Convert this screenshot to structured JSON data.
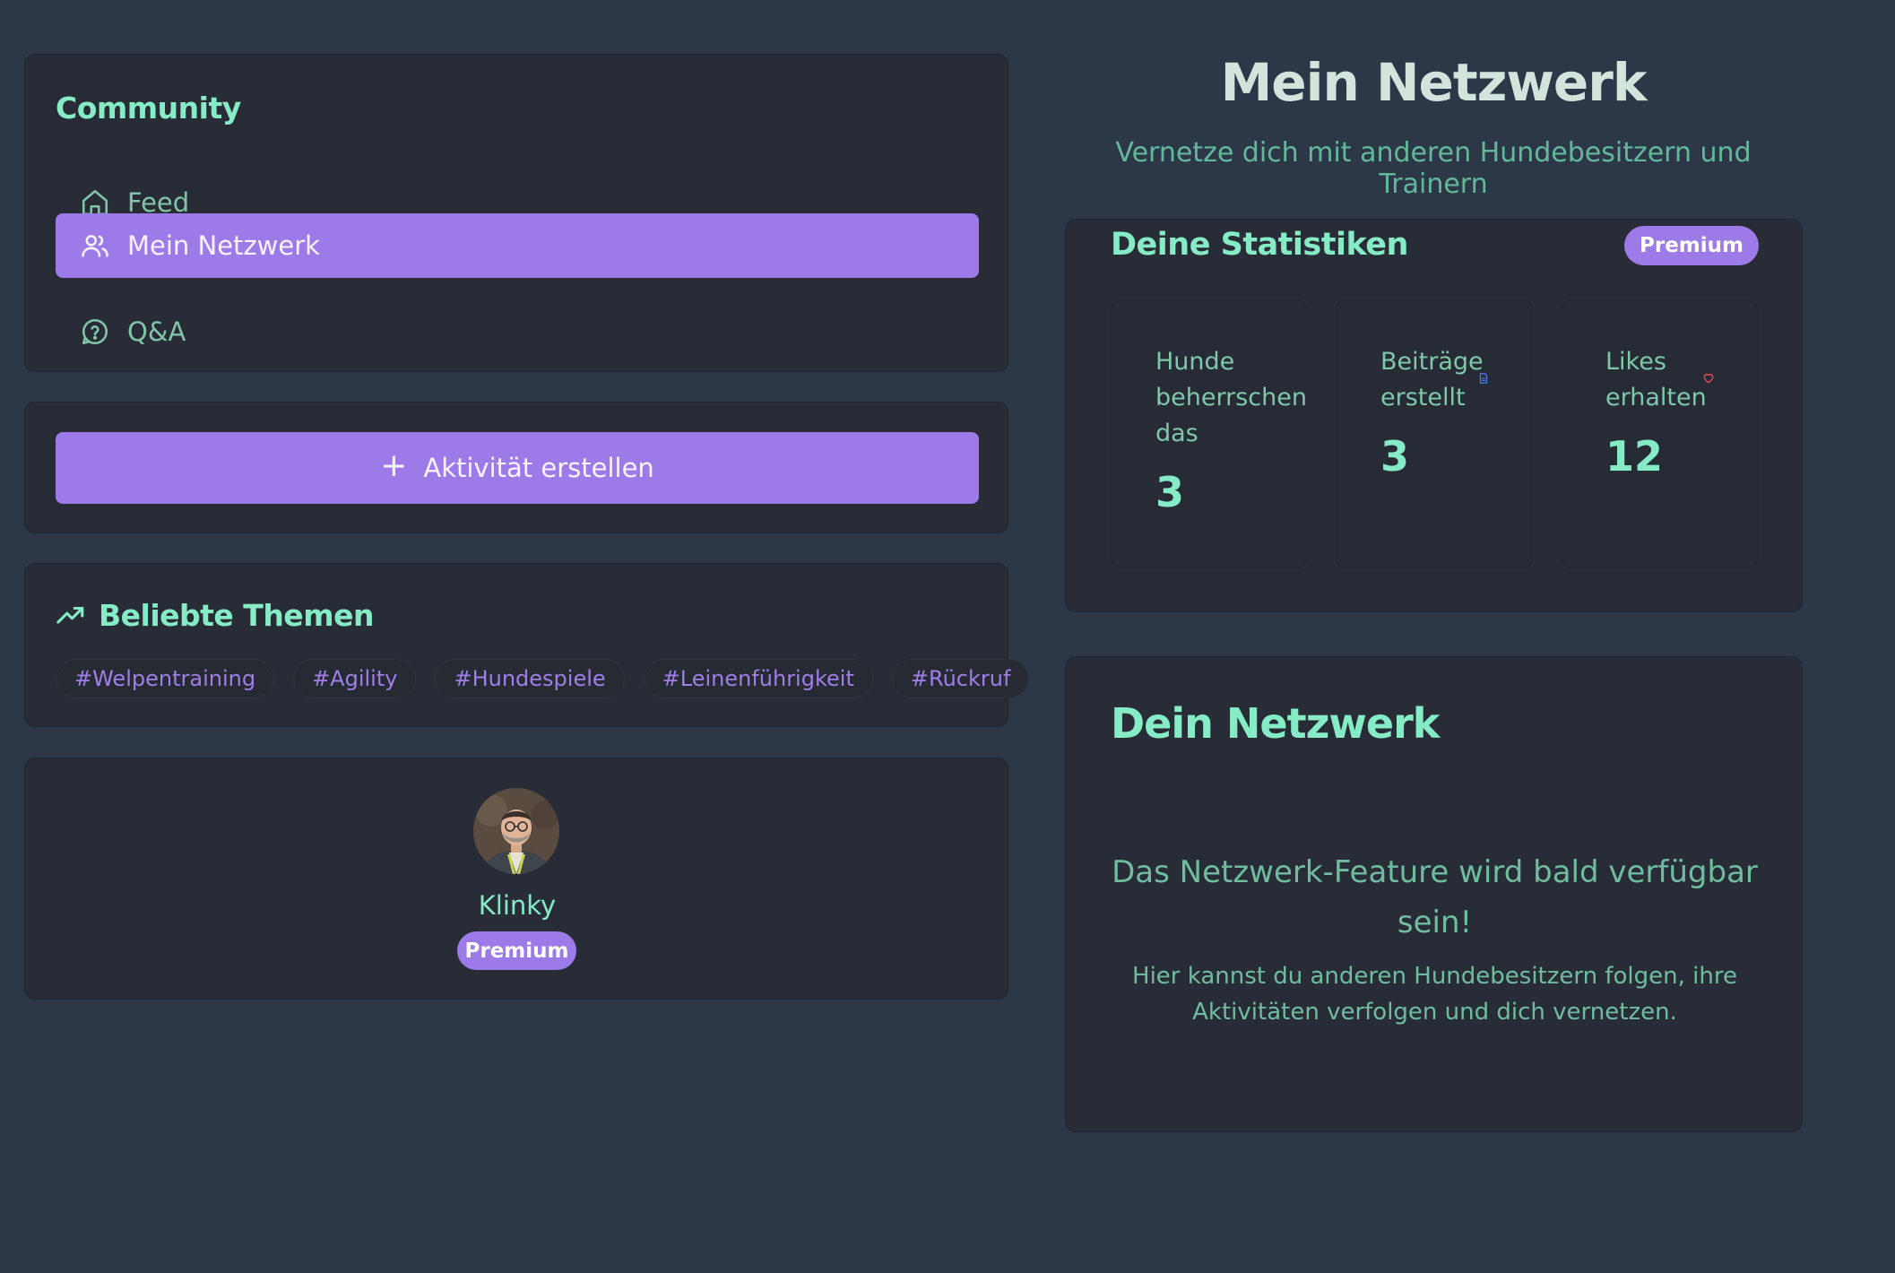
{
  "sidebar": {
    "heading": "Community",
    "items": [
      {
        "label": "Feed",
        "icon": "home-icon",
        "active": false
      },
      {
        "label": "Mein Netzwerk",
        "icon": "users-icon",
        "active": true
      },
      {
        "label": "Q&A",
        "icon": "help-circle-icon",
        "active": false
      }
    ]
  },
  "create": {
    "label": "Aktivität erstellen",
    "icon": "plus-icon"
  },
  "topics": {
    "heading": "Beliebte Themen",
    "icon": "trending-up-icon",
    "tags": [
      "#Welpentraining",
      "#Agility",
      "#Hundespiele",
      "#Leinenführigkeit",
      "#Rückruf"
    ]
  },
  "profile": {
    "name": "Klinky",
    "badge": "Premium"
  },
  "header": {
    "title": "Mein Netzwerk",
    "subtitle": "Vernetze dich mit anderen Hundebesitzern und Trainern"
  },
  "stats": {
    "title": "Deine Statistiken",
    "badge": "Premium",
    "items": [
      {
        "label": "Hunde beherrschen das",
        "value": "3"
      },
      {
        "label": "Beiträge erstellt",
        "value": "3",
        "icon": "document-icon"
      },
      {
        "label": "Likes erhalten",
        "value": "12",
        "icon": "heart-icon"
      }
    ]
  },
  "network": {
    "title": "Dein Netzwerk",
    "message": "Das Netzwerk-Feature wird bald verfügbar sein!",
    "description": "Hier kannst du anderen Hundebesitzern folgen, ihre Aktivitäten verfolgen und dich vernetzen."
  },
  "colors": {
    "background": "#2c3848",
    "card": "#282c36",
    "accent": "#9c7be9",
    "mint": "#86ecc6",
    "muted_green": "#6fbd9e"
  }
}
